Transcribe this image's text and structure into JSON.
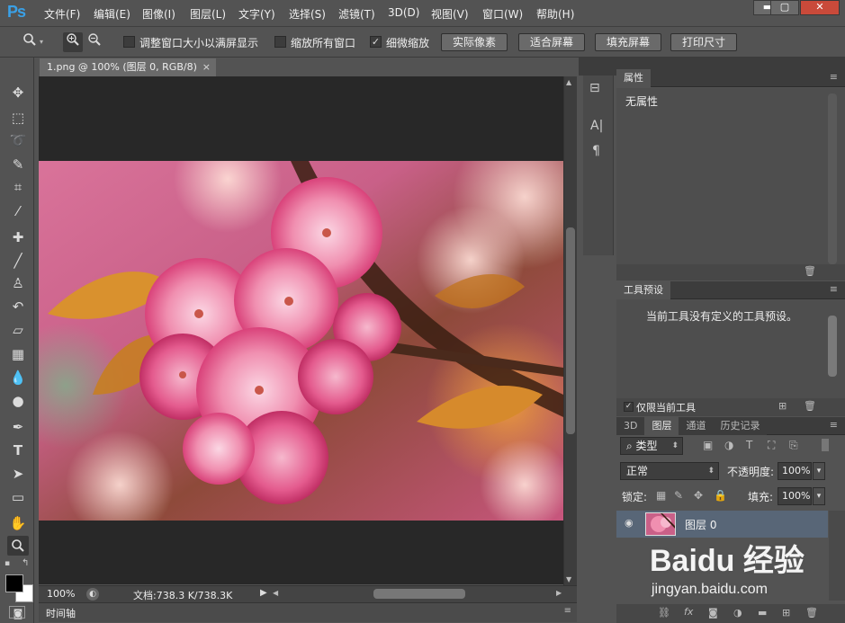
{
  "app": {
    "logo": "Ps"
  },
  "menu": {
    "items": [
      "文件(F)",
      "编辑(E)",
      "图像(I)",
      "图层(L)",
      "文字(Y)",
      "选择(S)",
      "滤镜(T)",
      "3D(D)",
      "视图(V)",
      "窗口(W)",
      "帮助(H)"
    ]
  },
  "window_controls": {
    "minimize": "▬",
    "maximize": "▢",
    "close": "✕"
  },
  "options": {
    "resize_windows": "调整窗口大小以满屏显示",
    "zoom_all_windows": "缩放所有窗口",
    "scrubby_zoom": "细微缩放",
    "scrubby_zoom_checked": "✓",
    "actual_pixels": "实际像素",
    "fit_screen": "适合屏幕",
    "fill_screen": "填充屏幕",
    "print_size": "打印尺寸"
  },
  "document": {
    "tab_title": "1.png @ 100% (图层 0, RGB/8)",
    "tab_close": "×",
    "zoom": "100%",
    "doc_size": "文档:738.3 K/738.3K",
    "timeline_label": "时间轴"
  },
  "properties": {
    "tab": "属性",
    "content": "无属性"
  },
  "tool_presets": {
    "tab": "工具预设",
    "content": "当前工具没有定义的工具预设。",
    "current_tool_only": "仅限当前工具"
  },
  "layers": {
    "tabs": [
      "3D",
      "图层",
      "通道",
      "历史记录"
    ],
    "kind_filter": "类型",
    "blend_mode": "正常",
    "opacity_label": "不透明度:",
    "opacity_value": "100%",
    "lock_label": "锁定:",
    "fill_label": "填充:",
    "fill_value": "100%",
    "layer_name": "图层 0"
  },
  "watermark": {
    "brand": "Baidu 经验",
    "url": "jingyan.baidu.com"
  },
  "icons": [
    "zoom-icon",
    "zoom-in-icon",
    "zoom-out-icon",
    "move-icon",
    "marquee-icon",
    "lasso-icon",
    "quick-select-icon",
    "crop-icon",
    "eyedropper-icon",
    "healing-icon",
    "brush-icon",
    "stamp-icon",
    "history-brush-icon",
    "eraser-icon",
    "gradient-icon",
    "blur-icon",
    "dodge-icon",
    "pen-icon",
    "type-icon",
    "path-select-icon",
    "shape-icon",
    "hand-icon",
    "eye-icon",
    "trash-icon",
    "fx-icon",
    "link-icon",
    "lock-icon"
  ],
  "colors": {
    "ui_bg": "#535353",
    "canvas_bg": "#282828",
    "selected_layer": "#586677",
    "ps_blue": "#3aa0e6"
  }
}
